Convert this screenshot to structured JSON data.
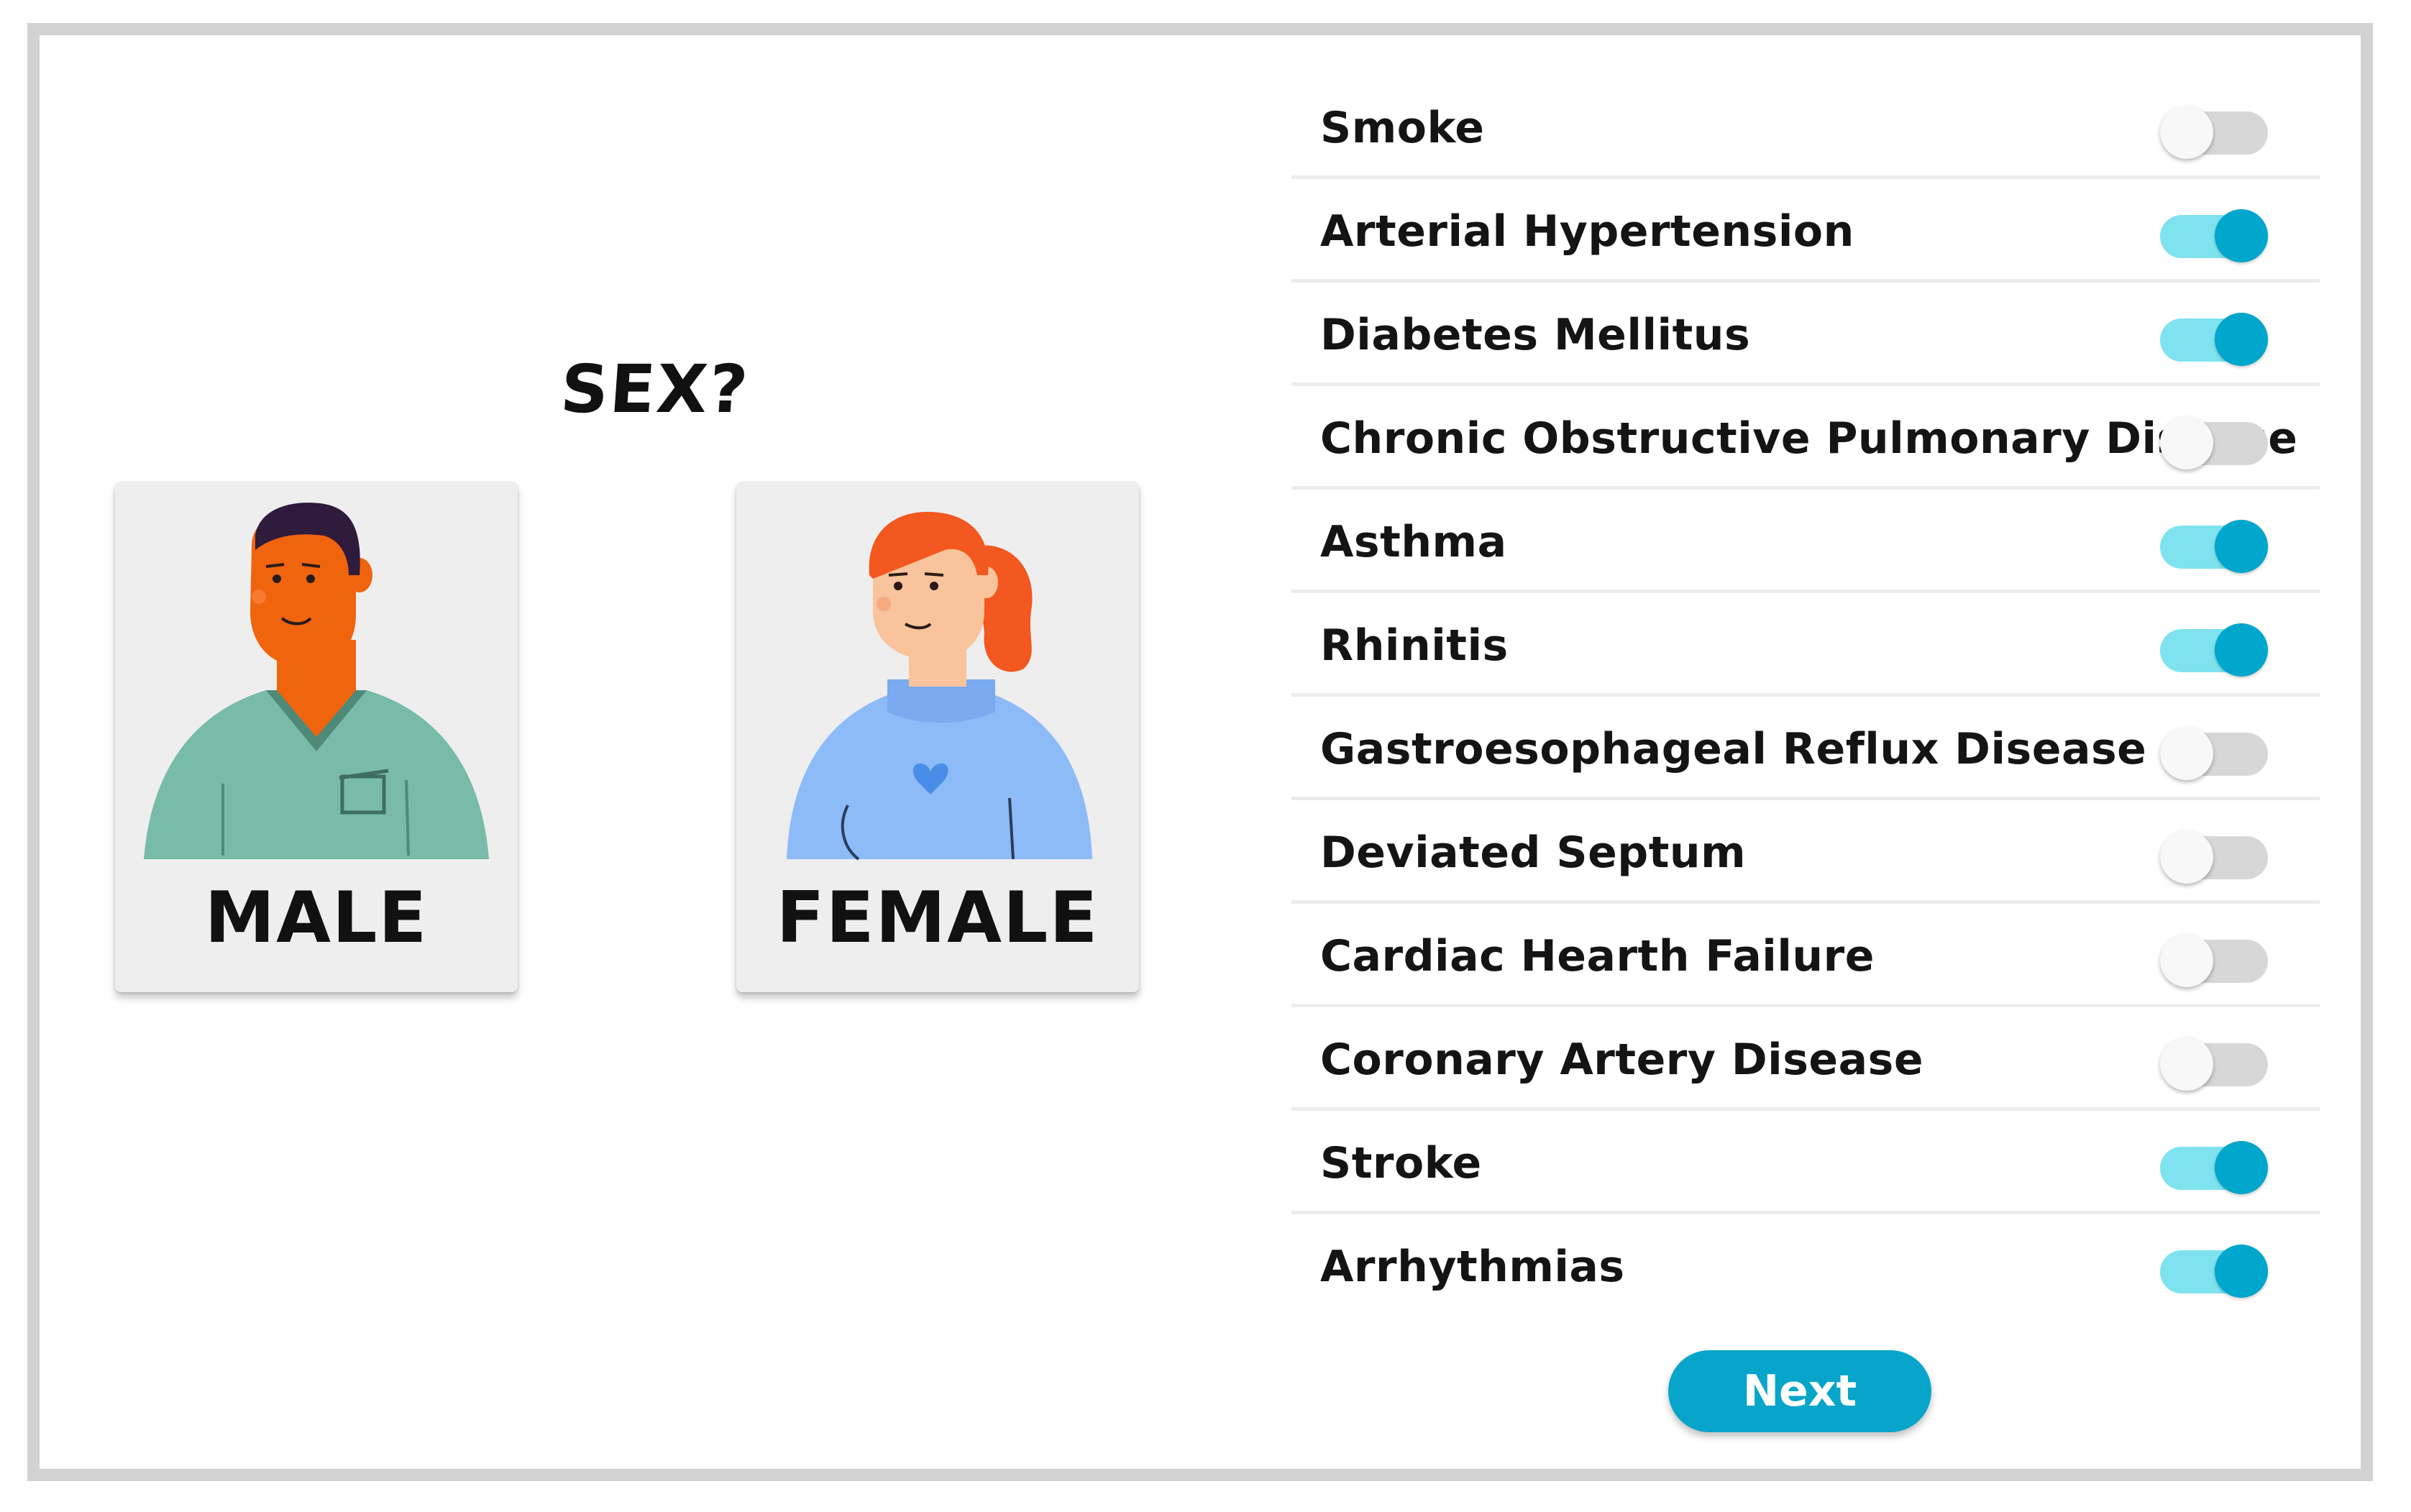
{
  "question": "SEX?",
  "options": [
    {
      "label": "MALE",
      "avatar": "male-avatar-icon"
    },
    {
      "label": "FEMALE",
      "avatar": "female-avatar-icon"
    }
  ],
  "conditions": [
    {
      "label": "Smoke",
      "enabled": false
    },
    {
      "label": "Arterial Hypertension",
      "enabled": true
    },
    {
      "label": "Diabetes Mellitus",
      "enabled": true
    },
    {
      "label": "Chronic Obstructive Pulmonary Disease",
      "enabled": false
    },
    {
      "label": "Asthma",
      "enabled": true
    },
    {
      "label": "Rhinitis",
      "enabled": true
    },
    {
      "label": "Gastroesophageal Reflux Disease",
      "enabled": false
    },
    {
      "label": "Deviated Septum",
      "enabled": false
    },
    {
      "label": "Cardiac Hearth Failure",
      "enabled": false
    },
    {
      "label": "Coronary Artery Disease",
      "enabled": false
    },
    {
      "label": "Stroke",
      "enabled": true
    },
    {
      "label": "Arrhythmias",
      "enabled": true
    }
  ],
  "next_label": "Next",
  "colors": {
    "accent": "#07a5c9",
    "toggle_on_track": "#7ee3ef",
    "toggle_off_track": "#d7d7d7"
  }
}
